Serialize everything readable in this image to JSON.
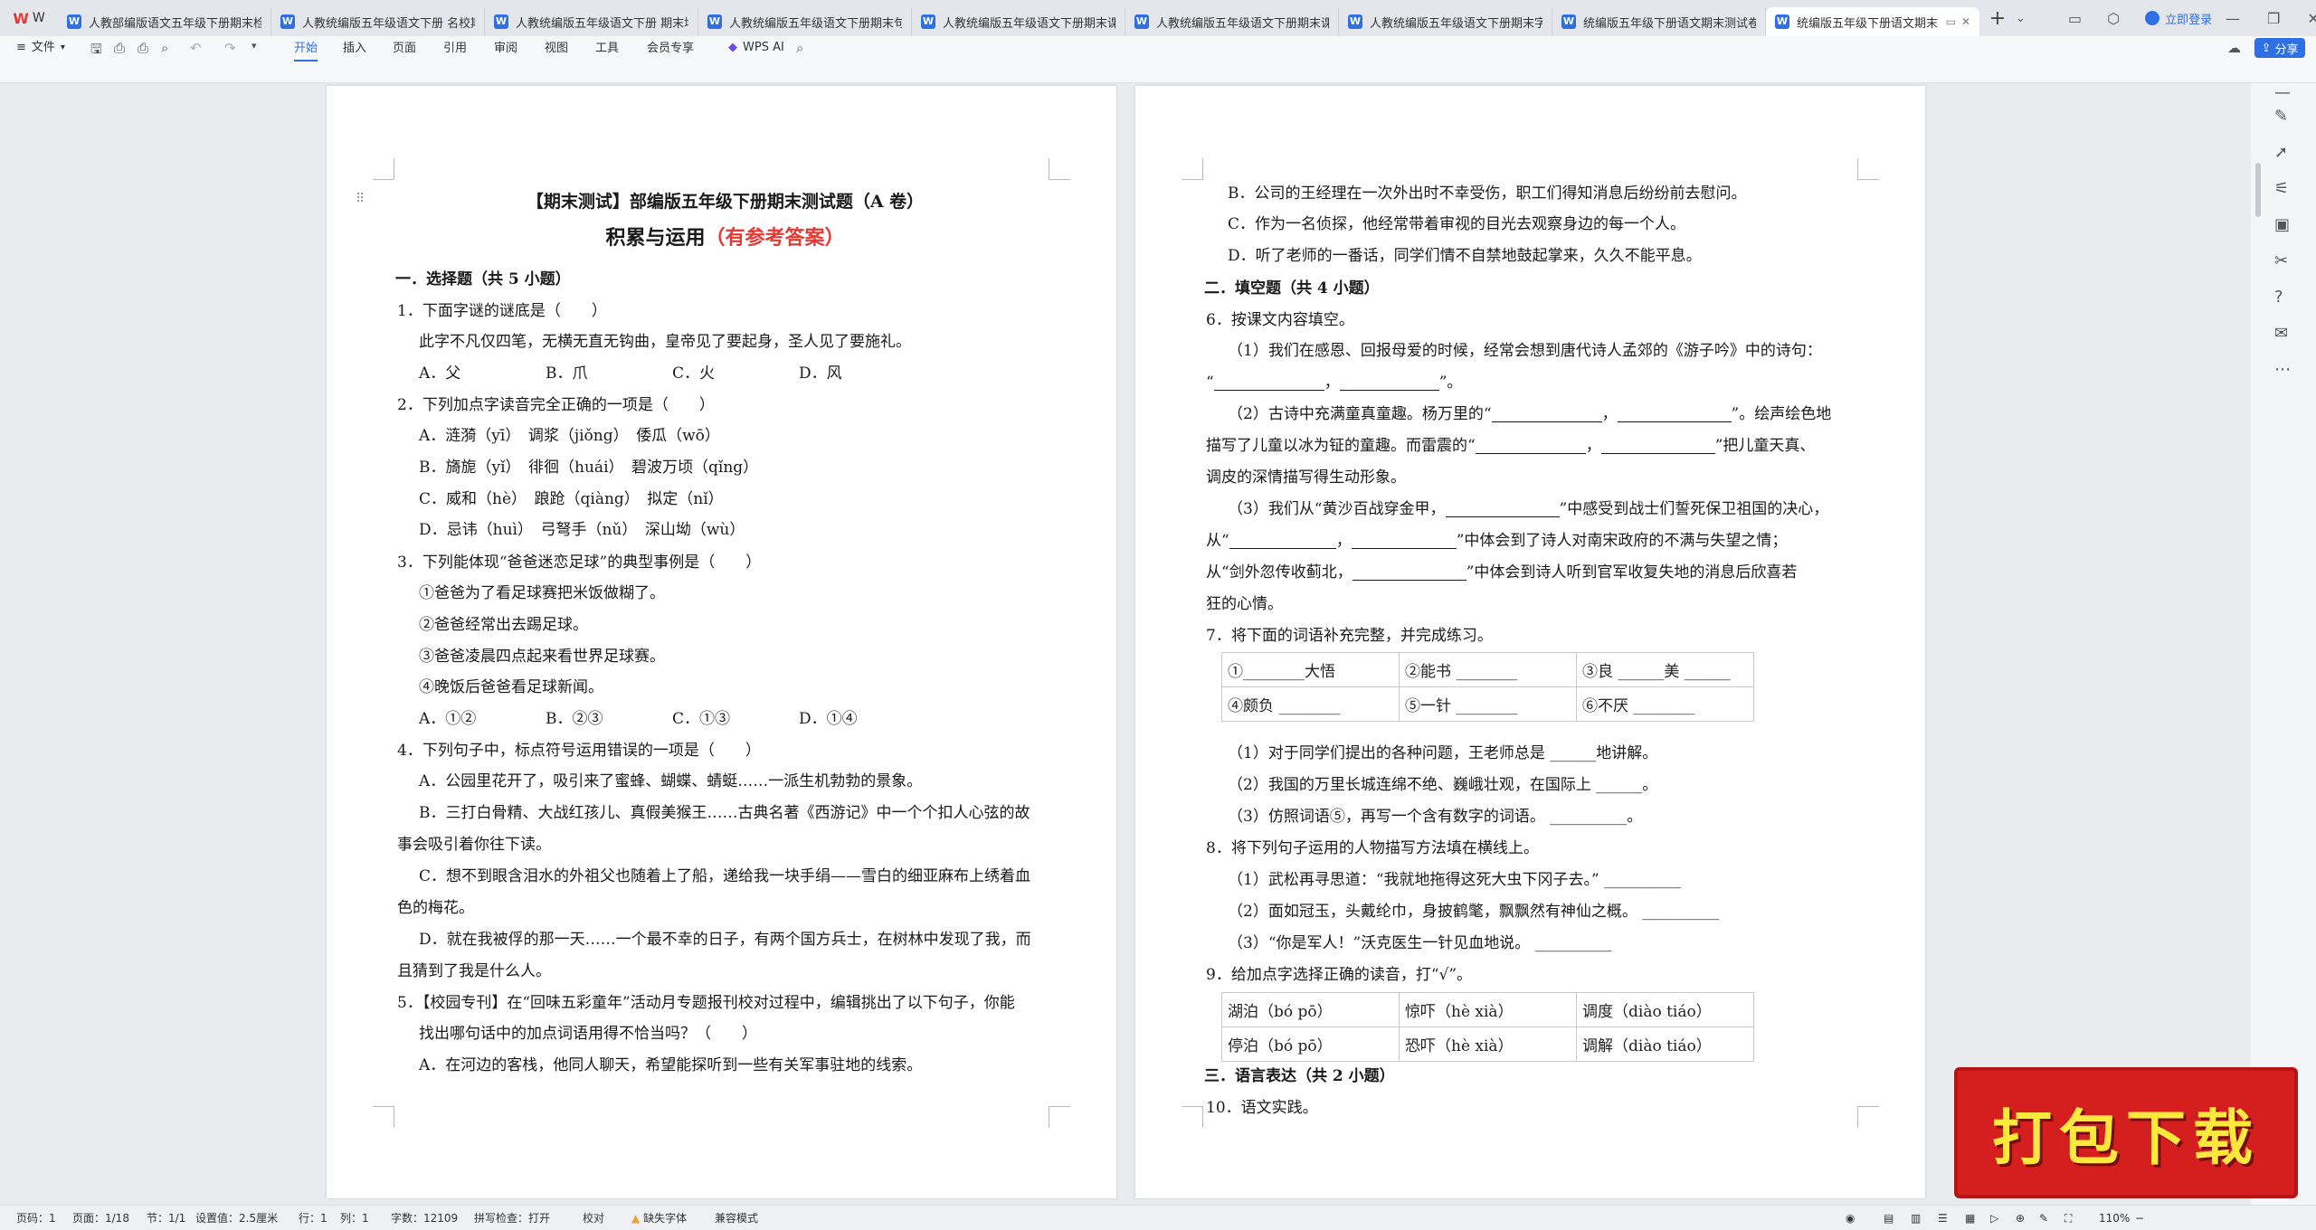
{
  "app": {
    "logo": "W"
  },
  "tabs": [
    {
      "label": "人教部编版语文五年级下册期末检测"
    },
    {
      "label": "人教统编版五年级语文下册 名校期末"
    },
    {
      "label": "人教统编版五年级语文下册 期末培优"
    },
    {
      "label": "人教统编版五年级语文下册期末句子"
    },
    {
      "label": "人教统编版五年级语文下册期末课内阅"
    },
    {
      "label": "人教统编版五年级语文下册期末课外阅"
    },
    {
      "label": "人教统编版五年级语文下册期末字词"
    },
    {
      "label": "统编版五年级下册语文期末测试卷"
    },
    {
      "label": "统编版五年级下册语文期末"
    }
  ],
  "titlebar": {
    "login": "立即登录"
  },
  "ribbon": {
    "file": "文件",
    "menus": [
      "开始",
      "插入",
      "页面",
      "引用",
      "审阅",
      "视图",
      "工具",
      "会员专享"
    ],
    "wps_ai": "WPS AI",
    "share": "分享"
  },
  "page1": {
    "title": "【期末测试】部编版五年级下册期末测试题（A 卷）",
    "subtitle": "积累与运用",
    "subtitle_red": "（有参考答案）",
    "sec1": "一．选择题（共 5 小题）",
    "q1": "1．下面字谜的谜底是（　　）",
    "q1_text": "此字不凡仅四笔，无横无直无钩曲，皇帝见了要起身，圣人见了要施礼。",
    "q1_opts": [
      "A．父",
      "B．爪",
      "C．火",
      "D．风"
    ],
    "q2": "2．下列加点字读音完全正确的一项是（　　）",
    "q2_a": "A．涟漪（yī）　调浆（jiǒng）　倭瓜（wō）",
    "q2_b": "B．旖旎（yǐ）　徘徊（huái）　碧波万顷（qǐng）",
    "q2_c": "C．威和（hè）　踉跄（qiàng）　拟定（nǐ）",
    "q2_d": "D．忌讳（huì）　弓弩手（nǔ）　深山坳（wù）",
    "q3": "3．下列能体现“爸爸迷恋足球”的典型事例是（　　）",
    "q3_1": "①爸爸为了看足球赛把米饭做糊了。",
    "q3_2": "②爸爸经常出去踢足球。",
    "q3_3": "③爸爸凌晨四点起来看世界足球赛。",
    "q3_4": "④晚饭后爸爸看足球新闻。",
    "q3_opts": [
      "A．①②",
      "B．②③",
      "C．①③",
      "D．①④"
    ],
    "q4": "4．下列句子中，标点符号运用错误的一项是（　　）",
    "q4_a": "A．公园里花开了，吸引来了蜜蜂、蝴蝶、蜻蜓……一派生机勃勃的景象。",
    "q4_b1": "B．三打白骨精、大战红孩儿、真假美猴王……古典名著《西游记》中一个个扣人心弦的故",
    "q4_b2": "事会吸引着你往下读。",
    "q4_c1": "C．想不到眼含泪水的外祖父也随着上了船，递给我一块手绢——雪白的细亚麻布上绣着血",
    "q4_c2": "色的梅花。",
    "q4_d1": "D．就在我被俘的那一天……一个最不幸的日子，有两个国方兵士，在树林中发现了我，而",
    "q4_d2": "且猜到了我是什么人。",
    "q5_1": "5．【校园专刊】在“回味五彩童年”活动月专题报刊校对过程中，编辑挑出了以下句子，你能",
    "q5_2": "找出哪句话中的加点词语用得不恰当吗？（　　）",
    "q5_a": "A．在河边的客栈，他同人聊天，希望能探听到一些有关军事驻地的线索。"
  },
  "page2": {
    "l_b": "B．公司的王经理在一次外出时不幸受伤，职工们得知消息后纷纷前去慰问。",
    "l_c": "C．作为一名侦探，他经常带着审视的目光去观察身边的每一个人。",
    "l_d": "D．听了老师的一番话，同学们情不自禁地鼓起掌来，久久不能平息。",
    "sec2": "二．填空题（共 4 小题）",
    "q6": "6．按课文内容填空。",
    "q6_1a": "（1）我们在感恩、回报母爱的时候，经常会想到唐代诗人孟郊的《游子吟》中的诗句：",
    "q6_1b_q": "“",
    "q6_1b_comma": "，",
    "q6_1b_end": "”。",
    "q6_2a_pre": "（2）古诗中充满童真童趣。杨万里的“",
    "q6_2a_mid": "，",
    "q6_2a_post": "”。绘声绘色地",
    "q6_2b_pre": "描写了儿童以冰为钲的童趣。而雷震的“",
    "q6_2b_mid": "，",
    "q6_2b_post": "”把儿童天真、",
    "q6_2c": "调皮的深情描写得生动形象。",
    "q6_3a_pre": "（3）我们从“黄沙百战穿金甲，",
    "q6_3a_post": "”中感受到战士们誓死保卫祖国的决心，",
    "q6_3b_pre": "从“",
    "q6_3b_mid": "，",
    "q6_3b_post": "”中体会到了诗人对南宋政府的不满与失望之情；",
    "q6_3c_pre": "从“剑外忽传收蓟北，",
    "q6_3c_post": "”中体会到诗人听到官军收复失地的消息后欣喜若",
    "q6_3d": "狂的心情。",
    "q7": "7．将下面的词语补充完整，并完成练习。",
    "q7_grid": [
      [
        "①________大悟",
        "②能书 ________",
        "③良 ______美 ______"
      ],
      [
        "④颇负 ________",
        "⑤一针 ________",
        "⑥不厌 ________"
      ]
    ],
    "q7_1": "（1）对于同学们提出的各种问题，王老师总是 ______地讲解。",
    "q7_2": "（2）我国的万里长城连绵不绝、巍峨壮观，在国际上 ______。",
    "q7_3": "（3）仿照词语⑤，再写一个含有数字的词语。 __________。",
    "q8": "8．将下列句子运用的人物描写方法填在横线上。",
    "q8_1": "（1）武松再寻思道：“我就地拖得这死大虫下冈子去。” __________",
    "q8_2": "（2）面如冠玉，头戴纶巾，身披鹤氅，飘飘然有神仙之概。 __________",
    "q8_3": "（3）“你是军人！”沃克医生一针见血地说。 __________",
    "q9": "9．给加点字选择正确的读音，打“√”。",
    "q9_grid": [
      [
        "湖泊（bó pō）",
        "惊吓（hè xià）",
        "调度（diào tiáo）"
      ],
      [
        "停泊（bó pō）",
        "恐吓（hè xià）",
        "调解（diào tiáo）"
      ]
    ],
    "sec3": "三．语言表达（共 2 小题）",
    "q10": "10．语文实践。"
  },
  "status": {
    "page": "页码：1",
    "pages": "页面：1/18",
    "section": "节：1/1",
    "setting": "设置值：2.5厘米",
    "row": "行：1",
    "col": "列：1",
    "words": "字数：12109",
    "spell": "拼写检查：打开",
    "proof": "校对",
    "font_missing": "缺失字体",
    "compat": "兼容模式",
    "zoom": "110%"
  },
  "banner": {
    "text": "打包下载"
  }
}
